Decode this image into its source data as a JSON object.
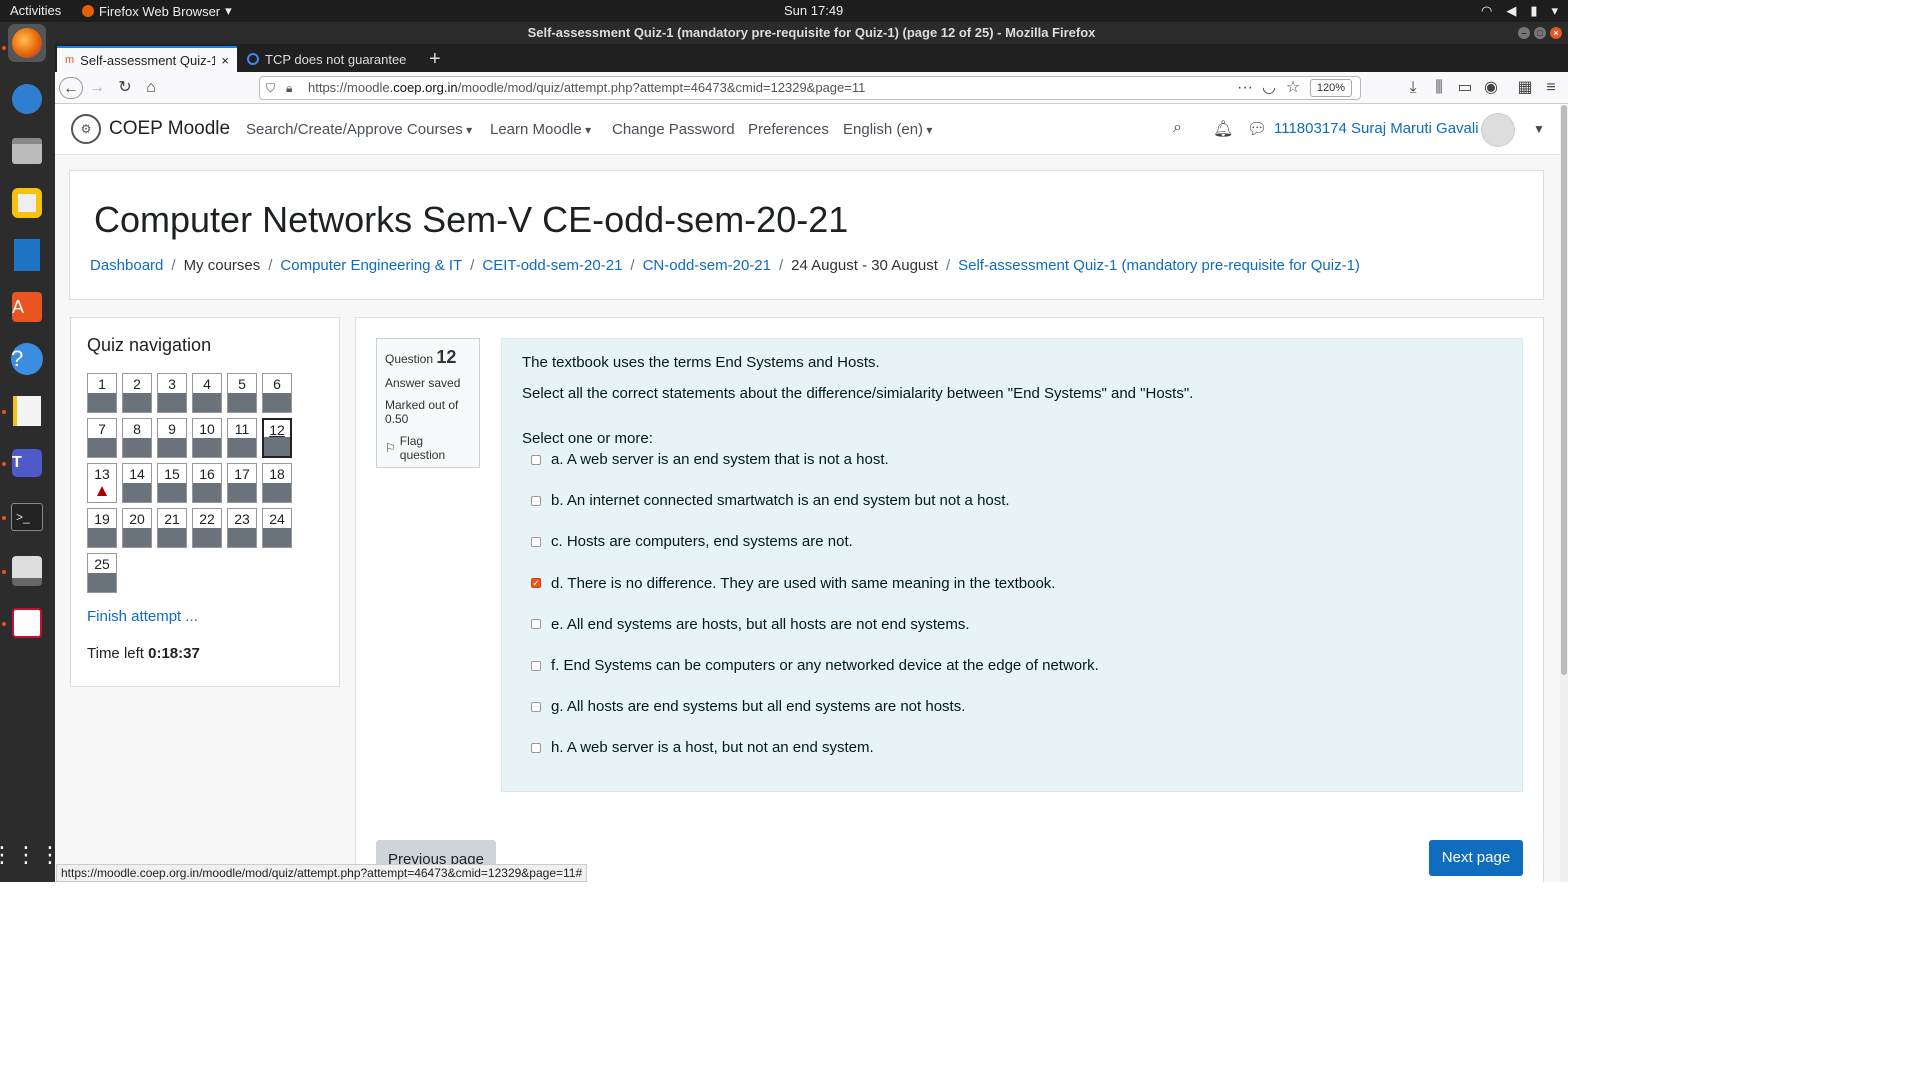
{
  "topbar": {
    "activities": "Activities",
    "app_name": "Firefox Web Browser",
    "clock": "Sun 17:49"
  },
  "window": {
    "title": "Self-assessment Quiz-1 (mandatory pre-requisite for Quiz-1) (page 12 of 25) - Mozilla Firefox"
  },
  "tabs": [
    {
      "label": "Self-assessment Quiz-1 ("
    },
    {
      "label": "TCP does not guarantee"
    }
  ],
  "navbar": {
    "url_prefix": "https://moodle.",
    "url_host": "coep.org.in",
    "url_rest": "/moodle/mod/quiz/attempt.php?attempt=46473&cmid=12329&page=11",
    "zoom": "120%"
  },
  "moodle": {
    "brand": "COEP Moodle",
    "menu": [
      "Search/Create/Approve Courses",
      "Learn Moodle",
      "Change Password",
      "Preferences",
      "English (en)"
    ],
    "user": "111803174 Suraj Maruti Gavali"
  },
  "header": {
    "title": "Computer Networks Sem-V CE-odd-sem-20-21",
    "breadcrumb": [
      "Dashboard",
      "My courses",
      "Computer Engineering & IT",
      "CEIT-odd-sem-20-21",
      "CN-odd-sem-20-21",
      "24 August - 30 August",
      "Self-assessment Quiz-1 (mandatory pre-requisite for Quiz-1)"
    ]
  },
  "quiznav": {
    "title": "Quiz navigation",
    "buttons": [
      "1",
      "2",
      "3",
      "4",
      "5",
      "6",
      "7",
      "8",
      "9",
      "10",
      "11",
      "12",
      "13",
      "14",
      "15",
      "16",
      "17",
      "18",
      "19",
      "20",
      "21",
      "22",
      "23",
      "24",
      "25"
    ],
    "current": "12",
    "flagged": "13",
    "finish": "Finish attempt ...",
    "time_label": "Time left",
    "time_value": "0:18:37"
  },
  "question": {
    "label": "Question",
    "number": "12",
    "state": "Answer saved",
    "marked": "Marked out of 0.50",
    "flag": "Flag question",
    "text1": "The textbook uses the terms End Systems and Hosts.",
    "text2": "Select all the correct statements about the difference/simialarity between \"End Systems\" and \"Hosts\".",
    "prompt": "Select one or more:",
    "options": [
      {
        "text": "a. A web server is an end system that is not a host.",
        "checked": false
      },
      {
        "text": "b. An internet connected smartwatch is an end system but not a host.",
        "checked": false
      },
      {
        "text": "c. Hosts are computers, end systems are not.",
        "checked": false
      },
      {
        "text": "d. There is no difference. They are used with same meaning in the textbook.",
        "checked": true
      },
      {
        "text": "e. All end systems are hosts, but all hosts are not end systems.",
        "checked": false
      },
      {
        "text": "f. End Systems can be computers or any networked device at the edge of network.",
        "checked": false
      },
      {
        "text": "g. All hosts are end systems but all end systems are not hosts.",
        "checked": false
      },
      {
        "text": "h. A web server is a host, but not an end system.",
        "checked": false
      }
    ],
    "prev": "Previous page",
    "next": "Next page"
  },
  "statusbar": "https://moodle.coep.org.in/moodle/mod/quiz/attempt.php?attempt=46473&cmid=12329&page=11#"
}
